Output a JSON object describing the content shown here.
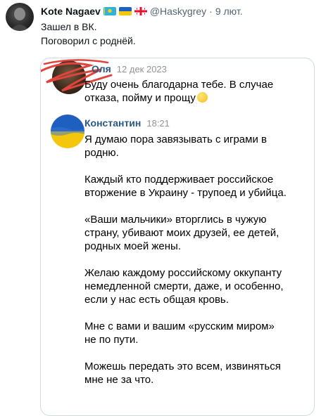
{
  "tweet": {
    "display_name": "Kote Nagaev",
    "handle": "@Haskygrey",
    "separator": "·",
    "time": "9 лют.",
    "text_lines": [
      "Зашел в ВК.",
      "Поговорил с роднёй."
    ]
  },
  "icons": {
    "author_avatar": "author-avatar",
    "flags": [
      "flag-kazakhstan-icon",
      "flag-ukraine-icon",
      "flag-georgia-icon"
    ],
    "emoji": "smiling-face-emoji"
  },
  "colors": {
    "vk_name": "#2a5885",
    "scribble": "#e0443c",
    "ukraine_blue": "#1f5fbf",
    "ukraine_yellow": "#f4c70d",
    "meta_gray": "#536471"
  },
  "message1": {
    "sender": "Оля",
    "time": "12 дек 2023",
    "lines": [
      "Буду очень благодарна тебе. В случае",
      "отказа, пойму и прощу"
    ]
  },
  "message2": {
    "sender": "Константин",
    "time": "18:21",
    "paragraphs": [
      [
        "Я думаю пора завязывать с играми в",
        "родню."
      ],
      [
        "Каждый кто поддерживает российское",
        "вторжение в Украину - трупоед и убийца."
      ],
      [
        "«Ваши мальчики» вторглись в чужую",
        "страну, убивают моих друзей, ее детей,",
        "родных моей жены."
      ],
      [
        "Желаю каждому российскому оккупанту",
        "немедленной смерти, даже, и особенно,",
        "если у нас есть общая кровь."
      ],
      [
        "Мне с вами и вашим «русским миром»",
        "не по пути."
      ],
      [
        "Можешь передать это всем, извиняться",
        "мне не за что."
      ]
    ]
  }
}
